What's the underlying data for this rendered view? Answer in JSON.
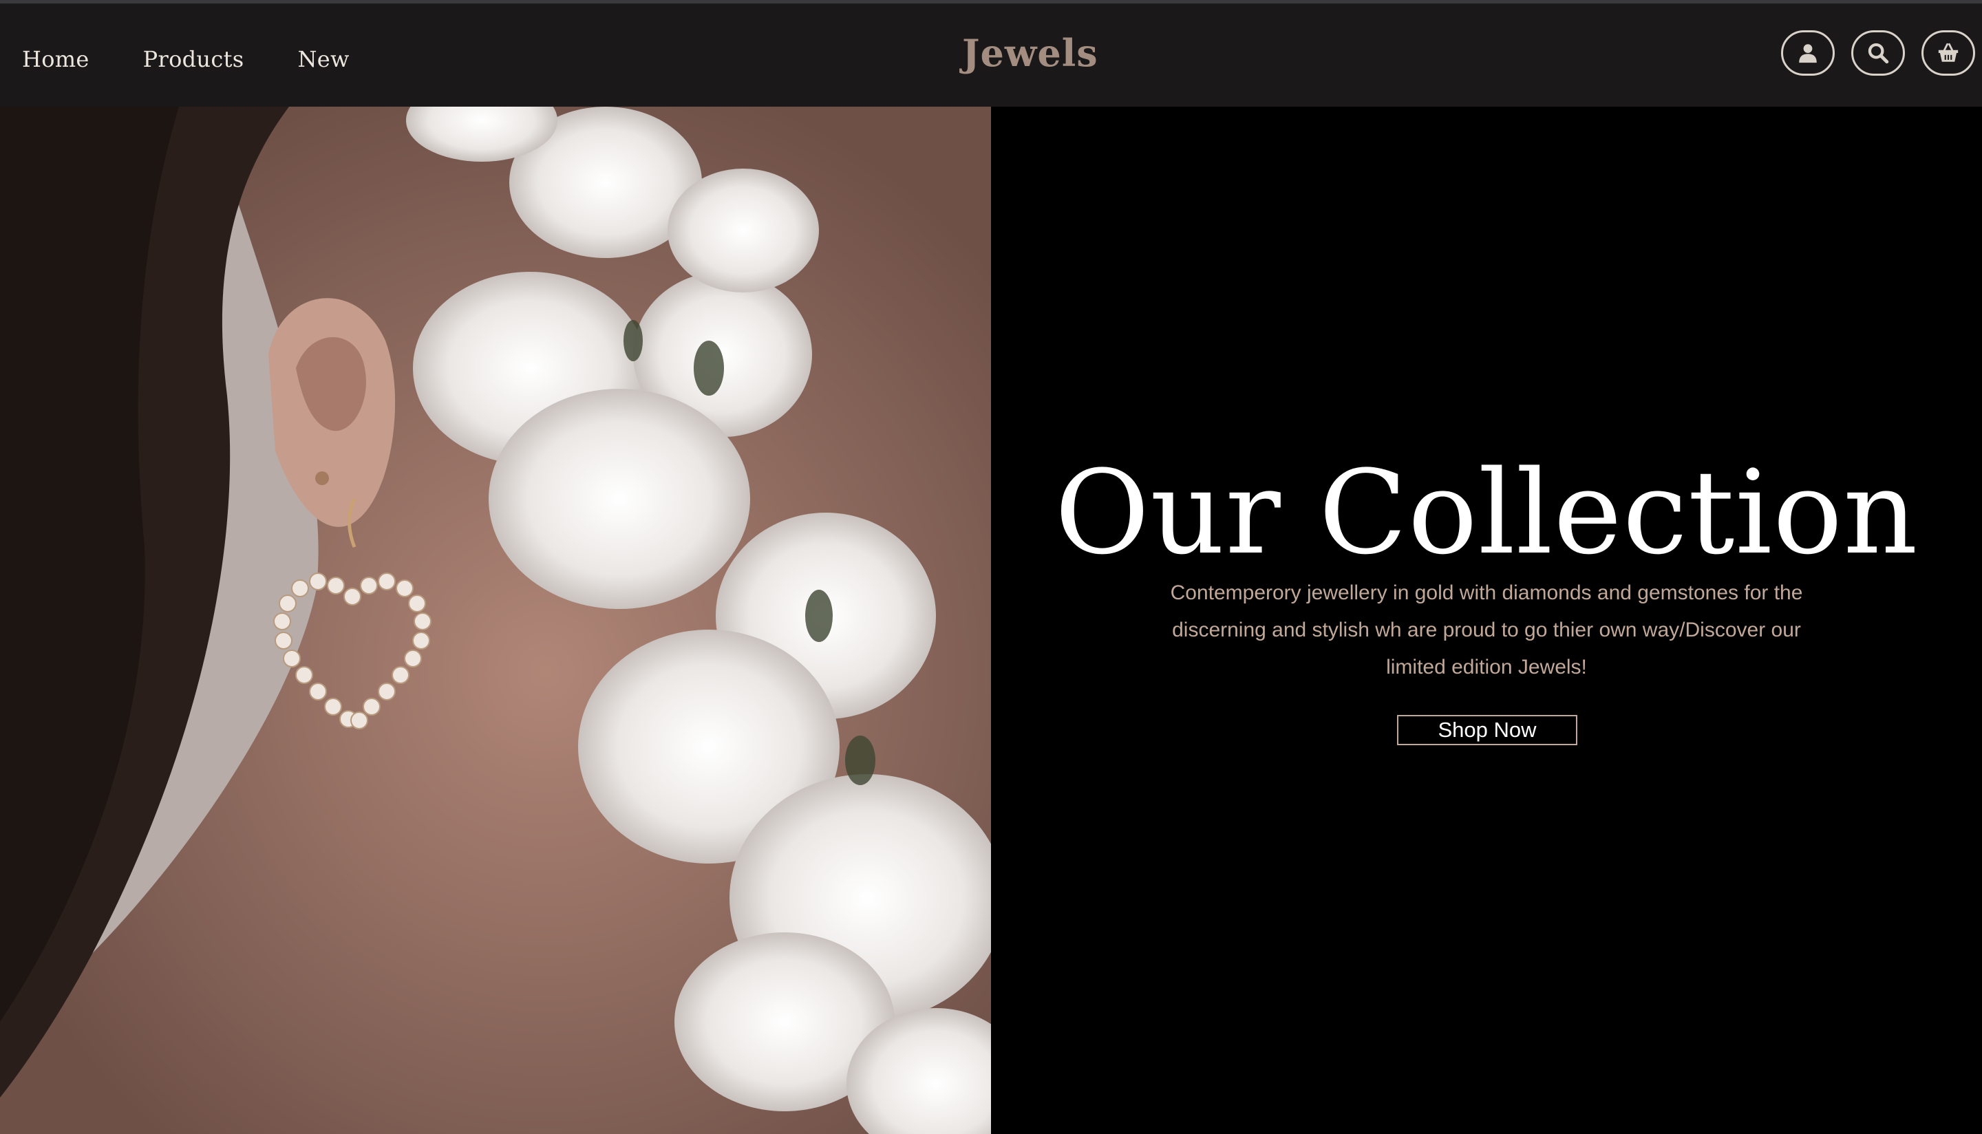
{
  "nav": {
    "links": [
      "Home",
      "Products",
      "New"
    ],
    "brand": "Jewels",
    "icons": [
      "user-icon",
      "search-icon",
      "basket-icon"
    ]
  },
  "hero": {
    "title": "Our Collection",
    "description": "Contemperory jewellery in gold with diamonds and gemstones for the discerning and stylish wh are proud to go thier own way/Discover our limited edition Jewels!",
    "button_label": "Shop Now"
  },
  "colors": {
    "navbar_bg": "#1a1818",
    "brand": "#a38d80",
    "accent_text": "#c1a899",
    "panel_bg": "#000000"
  }
}
